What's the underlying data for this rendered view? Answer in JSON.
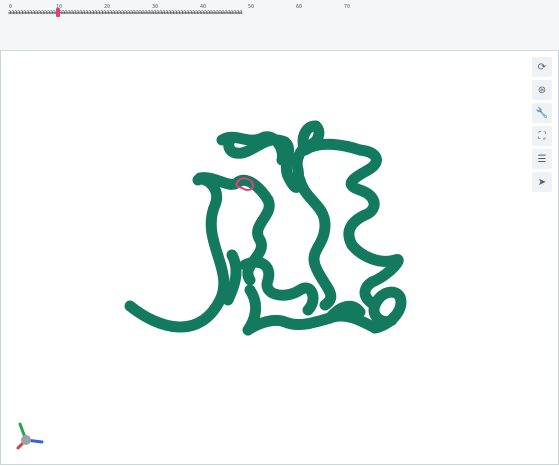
{
  "sequence_panel": {
    "ruler_ticks": [
      "0",
      "10",
      "20",
      "30",
      "40",
      "50",
      "60",
      "70"
    ],
    "sequence_text": "aaaaaaaaaaaaaaaaaaaaaaaaaaaaaaaaaaaaaaaaaaaaaaaaaaaaaaaaaaaaaaaaaaaaaaaaaaaaaaa"
  },
  "toolbar": {
    "buttons": [
      {
        "name": "reset-view",
        "icon": "refresh-icon",
        "glyph": "⟳"
      },
      {
        "name": "spin",
        "icon": "orbit-icon",
        "glyph": "⊛"
      },
      {
        "name": "settings",
        "icon": "wrench-icon",
        "glyph": "🔧"
      },
      {
        "name": "fullscreen",
        "icon": "expand-icon",
        "glyph": "⛶"
      },
      {
        "name": "controls",
        "icon": "sliders-icon",
        "glyph": "☰"
      },
      {
        "name": "selection-mode",
        "icon": "cursor-icon",
        "glyph": "➤"
      }
    ]
  },
  "viewer": {
    "cartoon_color": "#137a5f",
    "highlight_color": "#e0407a"
  },
  "axes": {
    "x_color": "#3a5fd0",
    "y_color": "#2aa34a",
    "z_color": "#d84040"
  }
}
